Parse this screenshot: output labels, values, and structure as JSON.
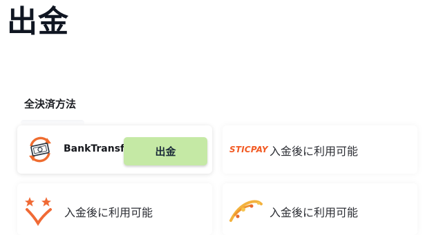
{
  "page": {
    "title": "出金"
  },
  "section": {
    "label": "全決済方法"
  },
  "methods": [
    {
      "name": "BankTransfer",
      "icon": "bank-transfer-icon",
      "action_label": "出金"
    },
    {
      "name": "STICPAY",
      "icon": "sticpay-logo-icon",
      "status": "入金後に利用可能"
    },
    {
      "icon": "star-v-logo-icon",
      "status": "入金後に利用可能"
    },
    {
      "icon": "crypto-wallet-logo-icon",
      "status": "入金後に利用可能"
    }
  ],
  "colors": {
    "button_bg": "#c5e9a5",
    "sticpay_orange": "#f25a23",
    "bank_icon_orange": "#ef6c2f"
  }
}
